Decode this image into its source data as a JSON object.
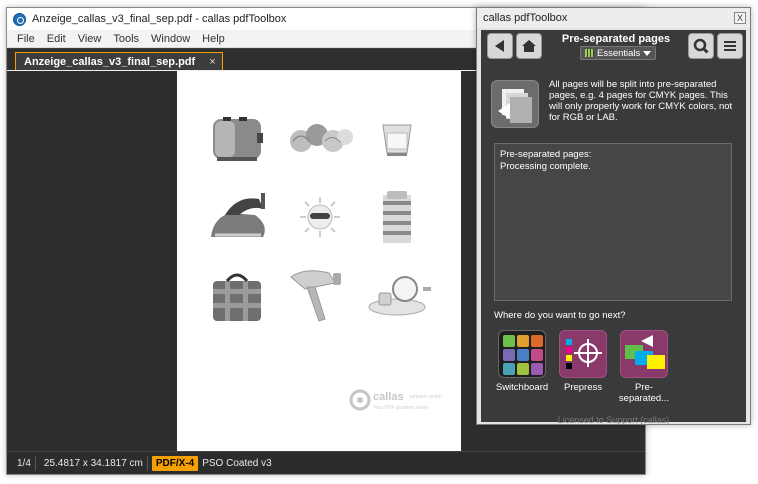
{
  "main_window": {
    "title": "Anzeige_callas_v3_final_sep.pdf - callas pdfToolbox",
    "menu": [
      "File",
      "Edit",
      "View",
      "Tools",
      "Window",
      "Help"
    ],
    "tab_label": "Anzeige_callas_v3_final_sep.pdf",
    "tab_close": "×",
    "status": {
      "page": "1/4",
      "size": "25.4817 x 34.1817 cm",
      "badge": "PDF/X-4",
      "profile": "PSO Coated v3"
    },
    "document_logo": {
      "brand": "callas",
      "tagline_top": "software gmbh",
      "tagline_bottom": "Your PDF problem solver"
    }
  },
  "panel": {
    "title": "callas pdfToolbox",
    "close": "X",
    "heading": "Pre-separated pages",
    "preset": "Essentials",
    "description": "All pages will be split into pre-separated pages, e.g. 4 pages for CMYK pages. This will only properly work for CMYK colors, not for RGB or LAB.",
    "log_lines": [
      "Pre-separated pages:",
      "Processing complete."
    ],
    "next_label": "Where do you want to go next?",
    "next_items": [
      {
        "label": "Switchboard",
        "icon": "switchboard-icon"
      },
      {
        "label": "Prepress",
        "icon": "prepress-icon"
      },
      {
        "label": "Pre-\nseparated...",
        "icon": "pre-separated-icon"
      }
    ],
    "license": "Licensed to Support (callas)"
  },
  "colors": {
    "accent": "#f3a000",
    "panel_bg": "#3a3a3a",
    "viewer_bg": "#2e2e2e"
  }
}
